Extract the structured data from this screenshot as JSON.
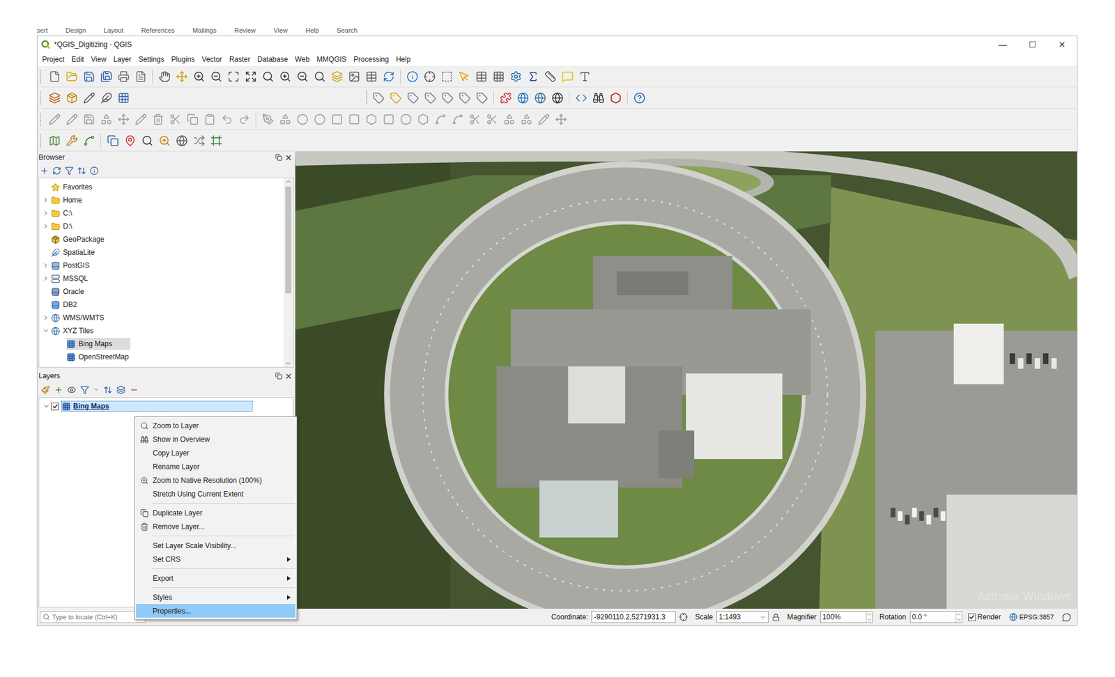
{
  "background_app": {
    "ribbon": [
      "sert",
      "Design",
      "Layout",
      "References",
      "Mailings",
      "Review",
      "View",
      "Help",
      "Search"
    ]
  },
  "window": {
    "title": "*QGIS_Digitizing - QGIS",
    "controls": [
      "—",
      "☐",
      "✕"
    ]
  },
  "menu": [
    "Project",
    "Edit",
    "View",
    "Layer",
    "Settings",
    "Plugins",
    "Vector",
    "Raster",
    "Database",
    "Web",
    "MMQGIS",
    "Processing",
    "Help"
  ],
  "browser": {
    "title": "Browser",
    "items": [
      {
        "label": "Favorites",
        "kind": "favorites",
        "level": 0,
        "expandable": false,
        "expanded": false,
        "selected": false
      },
      {
        "label": "Home",
        "kind": "folder",
        "level": 0,
        "expandable": true,
        "expanded": false,
        "selected": false
      },
      {
        "label": "C:\\",
        "kind": "folder",
        "level": 0,
        "expandable": true,
        "expanded": false,
        "selected": false
      },
      {
        "label": "D:\\",
        "kind": "folder",
        "level": 0,
        "expandable": true,
        "expanded": false,
        "selected": false
      },
      {
        "label": "GeoPackage",
        "kind": "geopackage",
        "level": 0,
        "expandable": false,
        "expanded": false,
        "selected": false
      },
      {
        "label": "SpatiaLite",
        "kind": "spatialite",
        "level": 0,
        "expandable": false,
        "expanded": false,
        "selected": false
      },
      {
        "label": "PostGIS",
        "kind": "postgis",
        "level": 0,
        "expandable": true,
        "expanded": false,
        "selected": false
      },
      {
        "label": "MSSQL",
        "kind": "mssql",
        "level": 0,
        "expandable": true,
        "expanded": false,
        "selected": false
      },
      {
        "label": "Oracle",
        "kind": "oracle",
        "level": 0,
        "expandable": false,
        "expanded": false,
        "selected": false
      },
      {
        "label": "DB2",
        "kind": "db2",
        "level": 0,
        "expandable": false,
        "expanded": false,
        "selected": false
      },
      {
        "label": "WMS/WMTS",
        "kind": "wms",
        "level": 0,
        "expandable": true,
        "expanded": false,
        "selected": false
      },
      {
        "label": "XYZ Tiles",
        "kind": "xyz",
        "level": 0,
        "expandable": true,
        "expanded": true,
        "selected": false
      },
      {
        "label": "Bing Maps",
        "kind": "tiles",
        "level": 1,
        "expandable": false,
        "expanded": false,
        "selected": true
      },
      {
        "label": "OpenStreetMap",
        "kind": "tiles",
        "level": 1,
        "expandable": false,
        "expanded": false,
        "selected": false
      }
    ]
  },
  "layers": {
    "title": "Layers",
    "items": [
      {
        "label": "Bing Maps",
        "expanded": true,
        "checked": true,
        "selected": true
      }
    ]
  },
  "context_menu": {
    "items": [
      {
        "kind": "item",
        "label": "Zoom to Layer",
        "submenu": false,
        "selected": false
      },
      {
        "kind": "item",
        "label": "Show in Overview",
        "submenu": false,
        "selected": false
      },
      {
        "kind": "item",
        "label": "Copy Layer",
        "submenu": false,
        "selected": false
      },
      {
        "kind": "item",
        "label": "Rename Layer",
        "submenu": false,
        "selected": false
      },
      {
        "kind": "item",
        "label": "Zoom to Native Resolution (100%)",
        "submenu": false,
        "selected": false
      },
      {
        "kind": "item",
        "label": "Stretch Using Current Extent",
        "submenu": false,
        "selected": false
      },
      {
        "kind": "separator"
      },
      {
        "kind": "item",
        "label": "Duplicate Layer",
        "submenu": false,
        "selected": false
      },
      {
        "kind": "item",
        "label": "Remove Layer...",
        "submenu": false,
        "selected": false
      },
      {
        "kind": "separator"
      },
      {
        "kind": "item",
        "label": "Set Layer Scale Visibility...",
        "submenu": false,
        "selected": false
      },
      {
        "kind": "item",
        "label": "Set CRS",
        "submenu": true,
        "selected": false
      },
      {
        "kind": "separator"
      },
      {
        "kind": "item",
        "label": "Export",
        "submenu": true,
        "selected": false
      },
      {
        "kind": "separator"
      },
      {
        "kind": "item",
        "label": "Styles",
        "submenu": true,
        "selected": false
      },
      {
        "kind": "item",
        "label": "Properties...",
        "submenu": false,
        "selected": true
      }
    ]
  },
  "status_bar": {
    "locate_placeholder": "Type to locate (Ctrl+K)",
    "coordinate_label": "Coordinate:",
    "coordinate": "-9290110.2,5271931.3",
    "scale_label": "Scale",
    "scale": "1:1493",
    "magnifier_label": "Magnifier",
    "magnifier": "100%",
    "rotation_label": "Rotation",
    "rotation": "0.0 °",
    "render_label": "Render",
    "render_checked": true,
    "crs": "EPSG:3857"
  },
  "watermark": {
    "text": "Activate Windows"
  }
}
